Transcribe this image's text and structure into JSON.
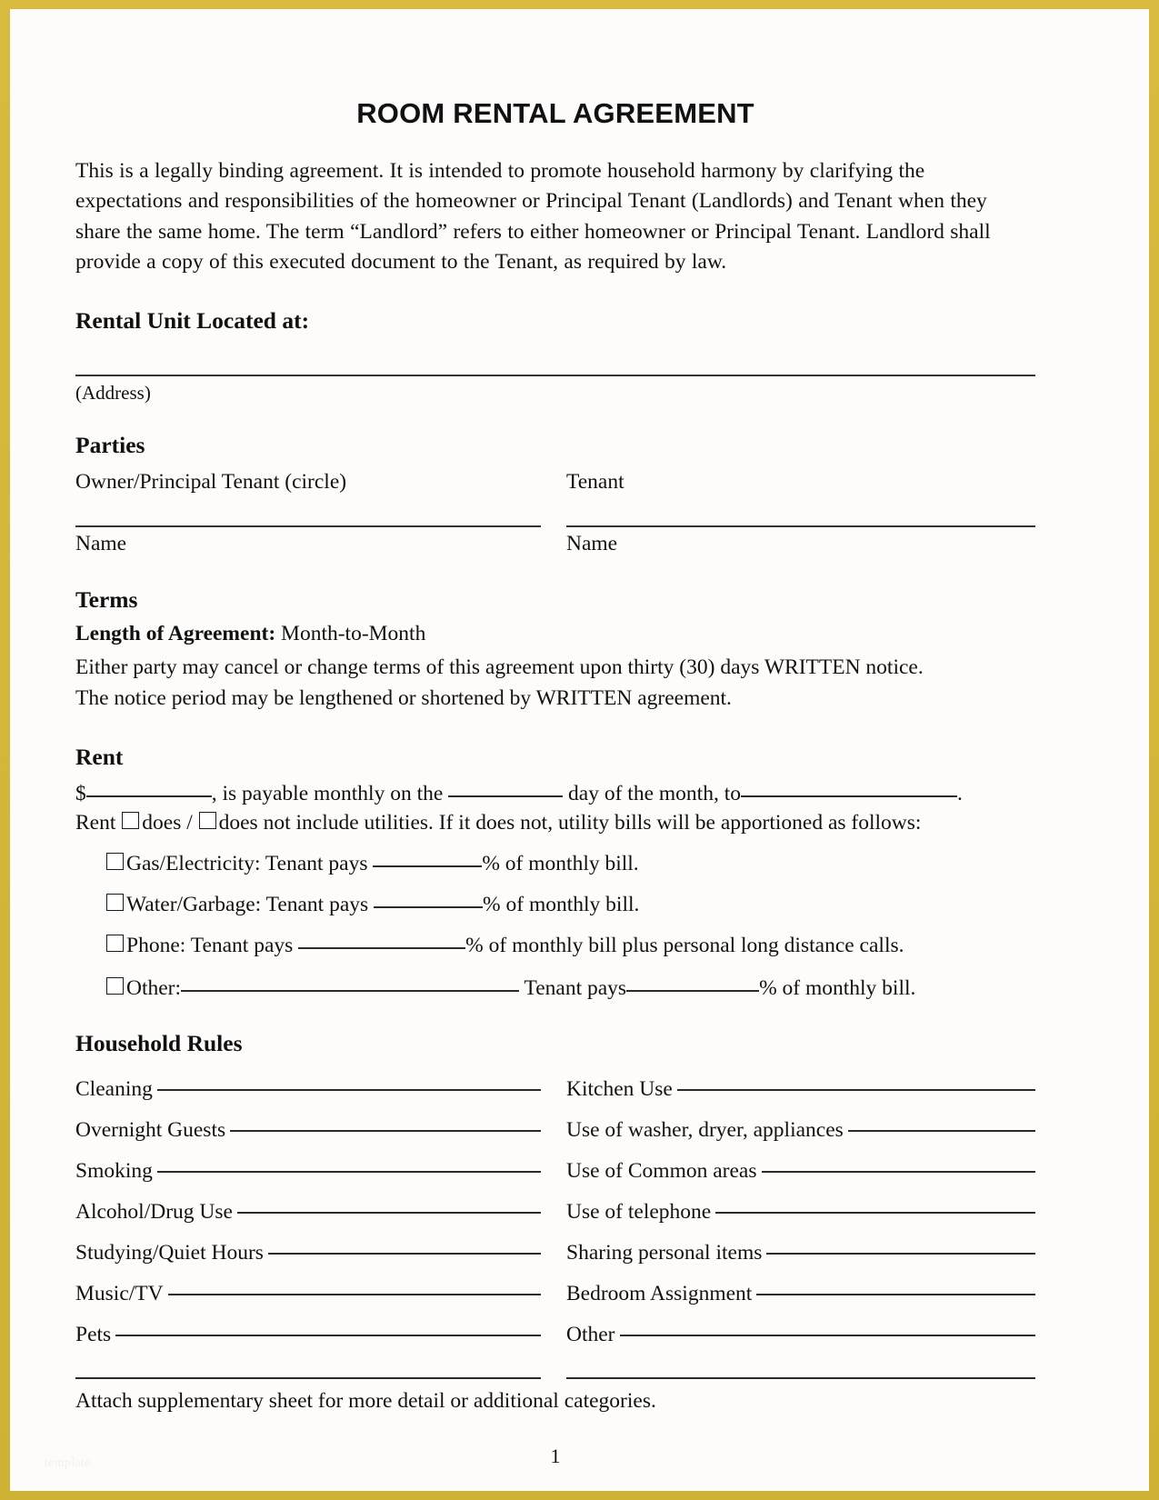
{
  "document": {
    "title": "ROOM RENTAL AGREEMENT",
    "intro": "This is a legally binding agreement.  It is intended to promote household harmony by clarifying the expectations and responsibilities of the homeowner or Principal Tenant (Landlords) and Tenant when they share the same home.  The term “Landlord” refers to either homeowner or Principal Tenant. Landlord shall provide a copy of this executed document to the Tenant, as required by law.",
    "page_number": "1",
    "watermark": "template",
    "border_color": "#d4b63c",
    "paper_color": "#fdfcfa",
    "ink_color": "#111111"
  },
  "rental_unit": {
    "heading": "Rental Unit Located at:",
    "address_caption": "(Address)",
    "address_value": ""
  },
  "parties": {
    "heading": "Parties",
    "owner_label": "Owner/Principal Tenant (circle)",
    "tenant_label": "Tenant",
    "owner_name_caption": "Name",
    "tenant_name_caption": "Name",
    "owner_name_value": "",
    "tenant_name_value": ""
  },
  "terms": {
    "heading": "Terms",
    "length_label": "Length of Agreement:",
    "length_value": "Month-to-Month",
    "body_line_1": "Either party may cancel or change terms of this agreement upon thirty (30) days WRITTEN notice.",
    "body_line_2": "The notice period may be lengthened or shortened by WRITTEN agreement."
  },
  "rent": {
    "heading": "Rent",
    "currency_symbol": "$",
    "amount_value": "",
    "text_after_amount": ", is payable monthly on the",
    "day_value": "",
    "text_after_day": "day of the month, to",
    "payable_to_value": "",
    "period": ".",
    "include_prefix": "Rent",
    "does_label": "does",
    "slash": "/",
    "does_not_label": "does not include utilities.  If it does not, utility bills will be apportioned as follows:",
    "does_checked": false,
    "does_not_checked": false,
    "utilities": [
      {
        "label": "Gas/Electricity: Tenant pays",
        "checked": false,
        "percent_value": "",
        "suffix": "% of monthly bill."
      },
      {
        "label": "Water/Garbage: Tenant pays",
        "checked": false,
        "percent_value": "",
        "suffix": "% of monthly bill."
      },
      {
        "label": "Phone: Tenant pays",
        "checked": false,
        "percent_value": "",
        "suffix": "% of monthly bill plus personal long distance calls."
      }
    ],
    "other": {
      "label": "Other:",
      "checked": false,
      "description_value": "",
      "middle_text": "Tenant pays",
      "percent_value": "",
      "suffix": "% of monthly bill."
    }
  },
  "household_rules": {
    "heading": "Household Rules",
    "rows": [
      {
        "left_label": "Cleaning",
        "left_value": "",
        "right_label": "Kitchen Use",
        "right_value": ""
      },
      {
        "left_label": "Overnight Guests",
        "left_value": "",
        "right_label": "Use of washer, dryer, appliances",
        "right_value": ""
      },
      {
        "left_label": "Smoking",
        "left_value": "",
        "right_label": "Use of Common areas",
        "right_value": ""
      },
      {
        "left_label": "Alcohol/Drug Use",
        "left_value": "",
        "right_label": "Use of telephone",
        "right_value": ""
      },
      {
        "left_label": "Studying/Quiet Hours",
        "left_value": "",
        "right_label": "Sharing personal items",
        "right_value": ""
      },
      {
        "left_label": "Music/TV",
        "left_value": "",
        "right_label": "Bedroom Assignment",
        "right_value": ""
      },
      {
        "left_label": "Pets",
        "left_value": "",
        "right_label": "Other",
        "right_value": ""
      },
      {
        "left_label": "",
        "left_value": "",
        "right_label": "",
        "right_value": ""
      }
    ],
    "attach_note": "Attach supplementary sheet for more detail or additional categories."
  }
}
